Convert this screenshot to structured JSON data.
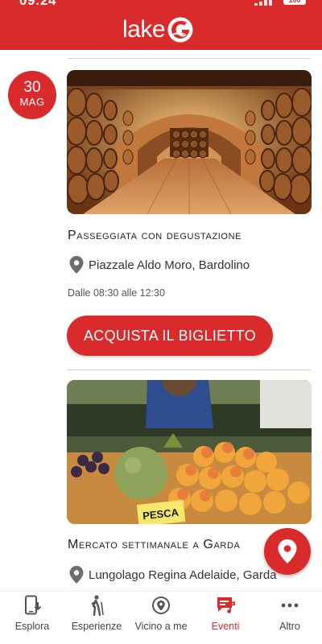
{
  "status_bar": {
    "time": "09:24",
    "battery": "100"
  },
  "header": {
    "logo_text": "lake"
  },
  "events": [
    {
      "date_day": "30",
      "date_month": "MAG",
      "title": "Passeggiata con degustazione",
      "location": "Piazzale Aldo Moro, Bardolino",
      "time": "Dalle 08:30 alle 12:30",
      "button_label": "ACQUISTA IL BIGLIETTO",
      "image": "wine-cellar-barrels"
    },
    {
      "title": "Mercato settimanale a Garda",
      "location": "Lungolago Regina Adelaide, Garda",
      "image": "market-fruit-stall",
      "image_sign": "PESCA"
    }
  ],
  "fab": {
    "icon": "map-pin-icon"
  },
  "bottom_nav": [
    {
      "label": "Esplora",
      "icon": "phone-download-icon",
      "active": false
    },
    {
      "label": "Esperienze",
      "icon": "hiker-icon",
      "active": false
    },
    {
      "label": "Vicino a me",
      "icon": "location-target-icon",
      "active": false
    },
    {
      "label": "Eventi",
      "icon": "events-icon",
      "active": true
    },
    {
      "label": "Altro",
      "icon": "more-dots-icon",
      "active": false
    }
  ],
  "colors": {
    "brand_red": "#d92a2c",
    "nav_text": "#444444",
    "divider": "#d3d3d3"
  }
}
